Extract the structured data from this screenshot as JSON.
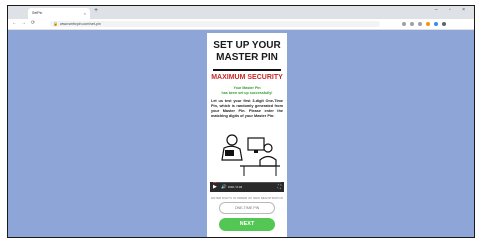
{
  "browser": {
    "tab_title": "SetPin",
    "tab_close": "×",
    "new_tab": "+",
    "window_controls": "– ▫ ×",
    "address": "www.smtrcpin.com/set-pin",
    "nav": {
      "back": "←",
      "forward": "→",
      "reload": "⟳"
    }
  },
  "page": {
    "title_line1": "SET UP YOUR",
    "title_line2": "MASTER PIN",
    "security_heading": "MAXIMUM SECURITY",
    "status_line1": "Your Master Pin",
    "status_line2": "has been set up successfully!",
    "body": "Let us test your first 3-digit One-Time Pin, which is randomly generated from your Master Pin. Please enter the matching digits of your Master Pin:",
    "video": {
      "play": "▶",
      "volume": "🔊",
      "time": "0:00 / 0:34",
      "fullscreen": "⛶",
      "progress": 0.05
    },
    "helper": "ENTER DIGITS IN ORDER OF NEW REGISTRATION",
    "otp_placeholder": "ONE-TIME PIN",
    "next_label": "NEXT"
  },
  "colors": {
    "background": "#8ea5d8",
    "accent_red": "#c62828",
    "success_green": "#2e9c2e",
    "button_green": "#53c653"
  }
}
